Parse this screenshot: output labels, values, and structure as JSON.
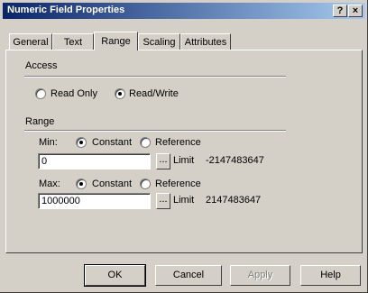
{
  "window": {
    "title": "Numeric Field Properties",
    "help_glyph": "?",
    "close_glyph": "×"
  },
  "tabs": [
    {
      "label": "General",
      "active": false
    },
    {
      "label": "Text",
      "active": false
    },
    {
      "label": "Range",
      "active": true
    },
    {
      "label": "Scaling",
      "active": false
    },
    {
      "label": "Attributes",
      "active": false
    }
  ],
  "access": {
    "heading": "Access",
    "options": [
      {
        "label": "Read Only",
        "checked": false
      },
      {
        "label": "Read/Write",
        "checked": true
      }
    ]
  },
  "range": {
    "heading": "Range",
    "min": {
      "label": "Min:",
      "mode_constant_label": "Constant",
      "mode_reference_label": "Reference",
      "selected_mode": "Constant",
      "value": "0",
      "browse_label": "...",
      "limit_label": "Limit",
      "limit_value": "-2147483647"
    },
    "max": {
      "label": "Max:",
      "mode_constant_label": "Constant",
      "mode_reference_label": "Reference",
      "selected_mode": "Constant",
      "value": "1000000",
      "browse_label": "...",
      "limit_label": "Limit",
      "limit_value": "2147483647"
    }
  },
  "buttons": {
    "ok": "OK",
    "cancel": "Cancel",
    "apply": "Apply",
    "help": "Help"
  },
  "colors": {
    "title_start": "#0a246a",
    "title_end": "#a6caf0",
    "face": "#d4d0c8"
  }
}
